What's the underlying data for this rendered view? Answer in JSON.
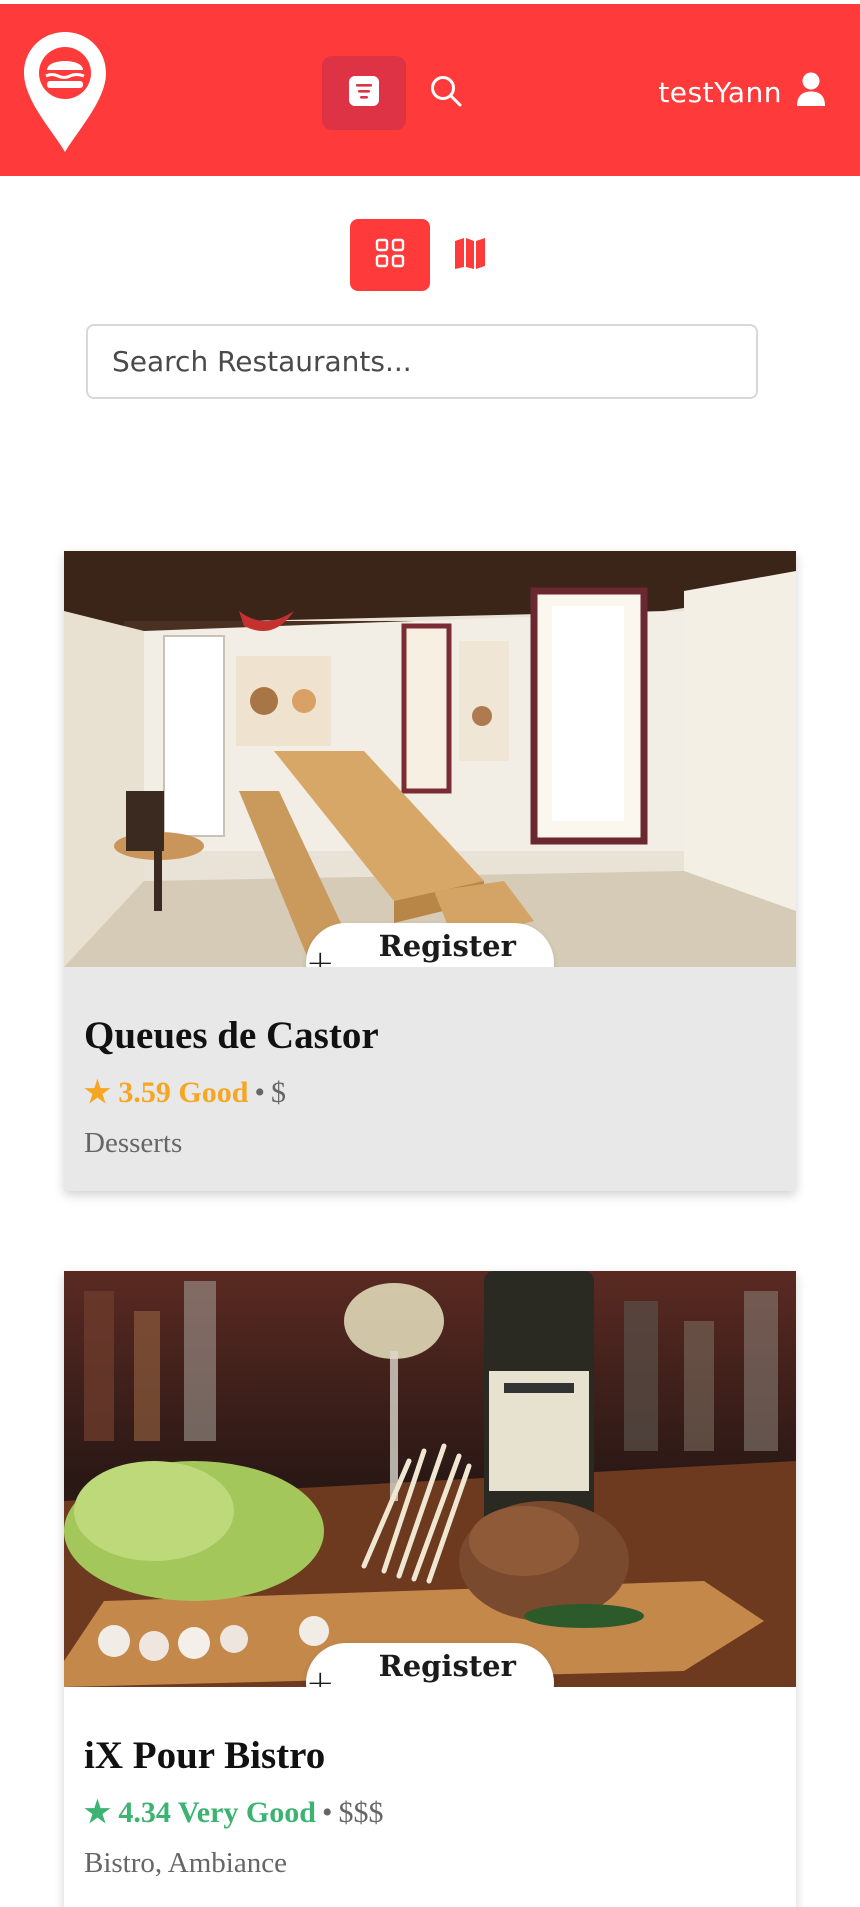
{
  "header": {
    "logo_icon": "burger-location-pin-icon",
    "tabs": [
      {
        "icon": "list-filter-icon",
        "active": true
      },
      {
        "icon": "search-icon",
        "active": false
      }
    ],
    "username": "testYann",
    "user_icon": "user-icon",
    "background_color": "#ff3a3a"
  },
  "view_toggle": {
    "options": [
      {
        "icon": "grid-icon",
        "active": true
      },
      {
        "icon": "map-icon",
        "active": false
      }
    ]
  },
  "search": {
    "placeholder": "Search Restaurants...",
    "value": ""
  },
  "restaurants": [
    {
      "name": "Queues de Castor",
      "rating": "3.59 Good",
      "rating_color": "#f5a623",
      "separator": "•",
      "price": "$",
      "tags": "Desserts",
      "register_label": "Register Visit"
    },
    {
      "name": "iX Pour Bistro",
      "rating": "4.34 Very Good",
      "rating_color": "#3cb371",
      "separator": "•",
      "price": "$$$",
      "tags": "Bistro, Ambiance",
      "register_label": "Register Visit"
    }
  ],
  "colors": {
    "accent": "#ff3a3a",
    "accent_dark": "#dd3345"
  }
}
